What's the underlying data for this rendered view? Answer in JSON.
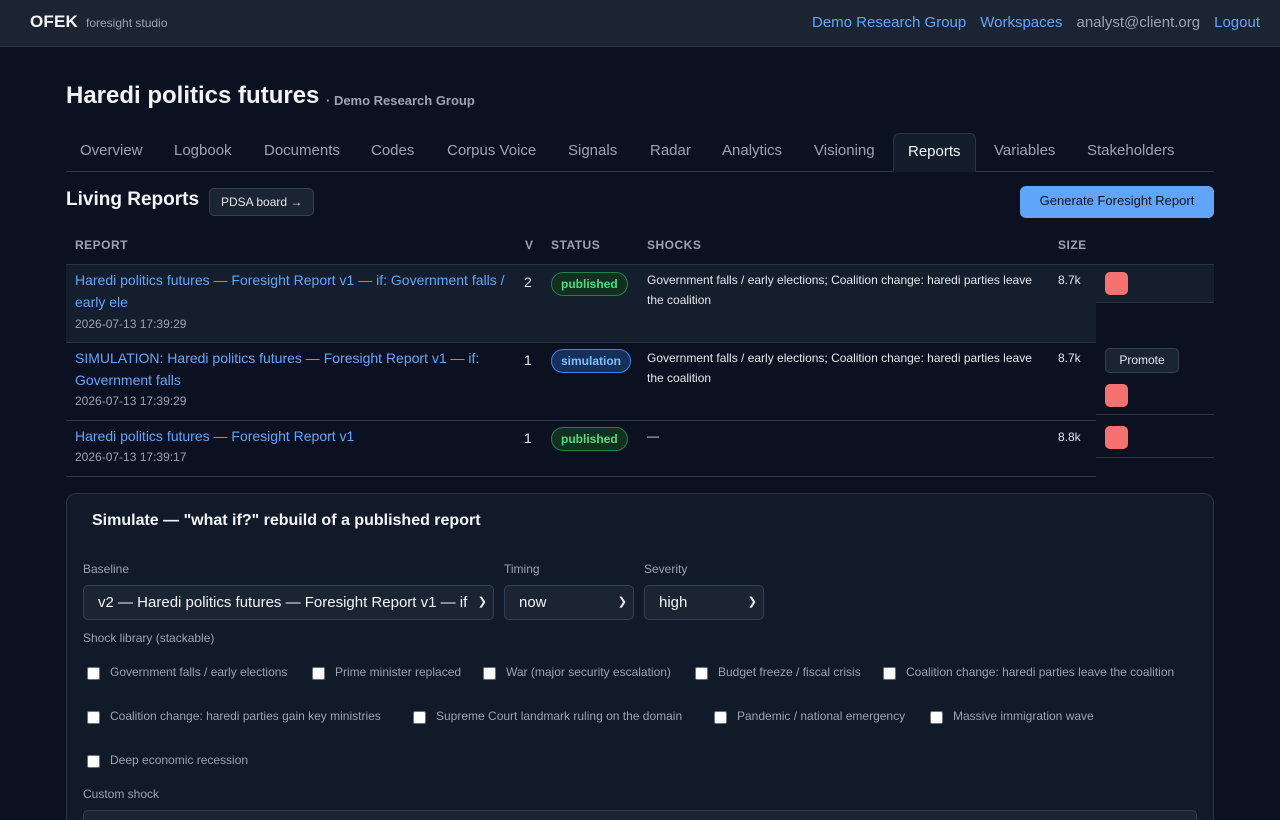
{
  "nav": {
    "brand": "OFEK",
    "brand_sub": "foresight studio",
    "links": [
      "Demo Research Group",
      "Workspaces"
    ],
    "user_email": "analyst@client.org",
    "logout": "Logout"
  },
  "page": {
    "title": "Haredi politics futures",
    "subtitle": "· Demo Research Group"
  },
  "tabs": [
    {
      "label": "Overview",
      "active": false
    },
    {
      "label": "Logbook",
      "active": false
    },
    {
      "label": "Documents",
      "active": false
    },
    {
      "label": "Codes",
      "active": false
    },
    {
      "label": "Corpus Voice",
      "active": false
    },
    {
      "label": "Signals",
      "active": false
    },
    {
      "label": "Radar",
      "active": false
    },
    {
      "label": "Analytics",
      "active": false
    },
    {
      "label": "Visioning",
      "active": false
    },
    {
      "label": "Reports",
      "active": true
    },
    {
      "label": "Variables",
      "active": false
    },
    {
      "label": "Stakeholders",
      "active": false
    }
  ],
  "reports": {
    "title": "Living Reports",
    "pdsa_button": "PDSA board →",
    "generate_button": "Generate Foresight Report",
    "columns": [
      "REPORT",
      "V",
      "STATUS",
      "SHOCKS",
      "SIZE"
    ],
    "rows": [
      {
        "title": "Haredi politics futures — Foresight Report v1 — if: Government falls / early ele",
        "date": "2026-07-13 17:39:29",
        "version": "2",
        "status": "published",
        "shocks": "Government falls / early elections; Coalition change: haredi parties leave the coalition",
        "size": "8.7k"
      },
      {
        "title": "SIMULATION: Haredi politics futures — Foresight Report v1 — if: Government falls",
        "date": "2026-07-13 17:39:29",
        "version": "1",
        "status": "simulation",
        "shocks": "Government falls / early elections; Coalition change: haredi parties leave the coalition",
        "size": "8.7k",
        "promote": "Promote"
      },
      {
        "title": "Haredi politics futures — Foresight Report v1",
        "date": "2026-07-13 17:39:17",
        "version": "1",
        "status": "published",
        "shocks": "—",
        "size": "8.8k"
      }
    ],
    "colors": {
      "published": "#4ade80",
      "simulation": "#7cc0ff",
      "delete": "#f87171",
      "accent": "#60a5fa"
    }
  },
  "simulate": {
    "title": "Simulate — \"what if?\" rebuild of a published report",
    "baseline_label": "Baseline",
    "baseline_value": "v2 — Haredi politics futures — Foresight Report v1 — if",
    "timing_label": "Timing",
    "timing_value": "now",
    "severity_label": "Severity",
    "severity_value": "high",
    "library_label": "Shock library (stackable)",
    "shocks": [
      "Government falls / early elections",
      "Prime minister replaced",
      "War (major security escalation)",
      "Budget freeze / fiscal crisis",
      "Coalition change: haredi parties leave the coalition",
      "Coalition change: haredi parties gain key ministries",
      "Supreme Court landmark ruling on the domain",
      "Pandemic / national emergency",
      "Massive immigration wave",
      "Deep economic recession"
    ],
    "custom_label": "Custom shock"
  }
}
